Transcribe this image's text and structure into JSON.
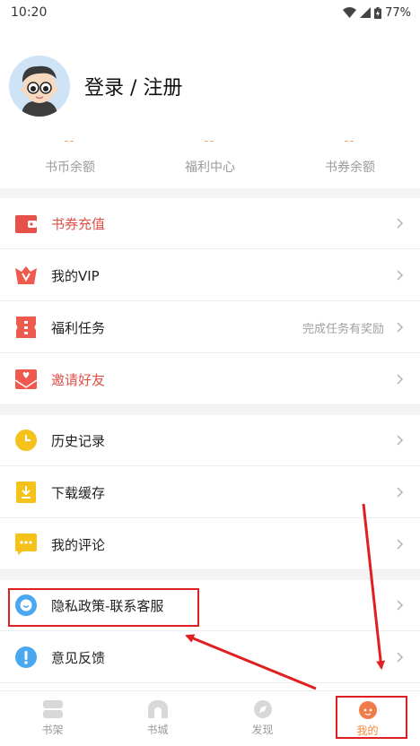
{
  "status_bar": {
    "time": "10:20",
    "battery": "77%"
  },
  "profile": {
    "login_text": "登录 / 注册"
  },
  "stats": [
    {
      "value": "--",
      "label": "书币余额"
    },
    {
      "value": "--",
      "label": "福利中心"
    },
    {
      "value": "--",
      "label": "书券余额"
    }
  ],
  "menu_group1": [
    {
      "label": "书券充值",
      "icon": "wallet-icon",
      "color": "#e8514a"
    },
    {
      "label": "我的VIP",
      "icon": "vip-icon",
      "color": "#ef5a4f"
    },
    {
      "label": "福利任务",
      "icon": "ticket-icon",
      "color": "#ef5a4f",
      "hint": "完成任务有奖励"
    },
    {
      "label": "邀请好友",
      "icon": "envelope-icon",
      "color": "#ef5a4f"
    }
  ],
  "menu_group2": [
    {
      "label": "历史记录",
      "icon": "clock-icon",
      "color": "#f5c21a"
    },
    {
      "label": "下载缓存",
      "icon": "download-icon",
      "color": "#f5c21a"
    },
    {
      "label": "我的评论",
      "icon": "comment-icon",
      "color": "#f5c21a"
    }
  ],
  "menu_group3": [
    {
      "label": "隐私政策-联系客服",
      "icon": "chat-icon",
      "color": "#4aa8f0"
    },
    {
      "label": "意见反馈",
      "icon": "exclamation-icon",
      "color": "#4aa8f0"
    }
  ],
  "tabs": [
    {
      "label": "书架",
      "icon": "bookshelf-icon"
    },
    {
      "label": "书城",
      "icon": "bookstore-icon"
    },
    {
      "label": "发现",
      "icon": "discover-icon"
    },
    {
      "label": "我的",
      "icon": "profile-tab-icon",
      "active": true
    }
  ],
  "annotation_color": "#e02020"
}
